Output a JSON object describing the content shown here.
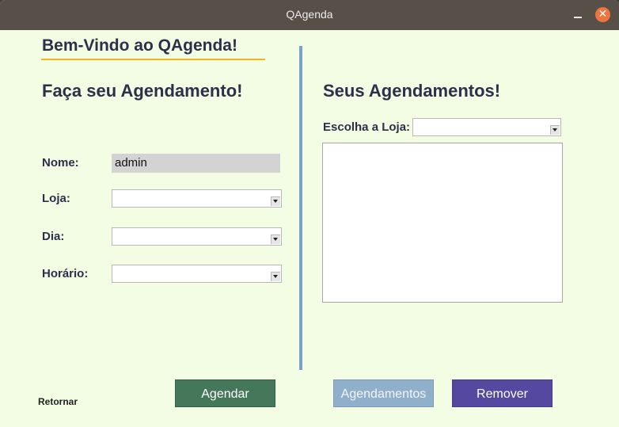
{
  "window": {
    "title": "QAgenda"
  },
  "header": {
    "welcome": "Bem-Vindo ao QAgenda!"
  },
  "left_panel": {
    "heading": "Faça seu Agendamento!",
    "name_label": "Nome:",
    "name_value": "admin",
    "store_label": "Loja:",
    "store_value": "",
    "day_label": "Dia:",
    "day_value": "",
    "time_label": "Horário:",
    "time_value": ""
  },
  "right_panel": {
    "heading": "Seus Agendamentos!",
    "choose_store_label": "Escolha a Loja:",
    "choose_store_value": "",
    "appointments": []
  },
  "buttons": {
    "schedule": "Agendar",
    "appointments": "Agendamentos",
    "remove": "Remover",
    "back": "Retornar"
  },
  "colors": {
    "background": "#f2fde4",
    "titlebar": "#575049",
    "heading": "#2e2f4a",
    "accent_underline": "#f4b321",
    "divider": "#7aa0cf",
    "schedule_button": "#45775a",
    "appointments_button": "#8fafca",
    "remove_button": "#5548a0",
    "close_button": "#f0743e"
  },
  "icons": {
    "minimize": "minimize-icon",
    "close": "close-icon",
    "dropdown": "chevron-down-icon"
  }
}
